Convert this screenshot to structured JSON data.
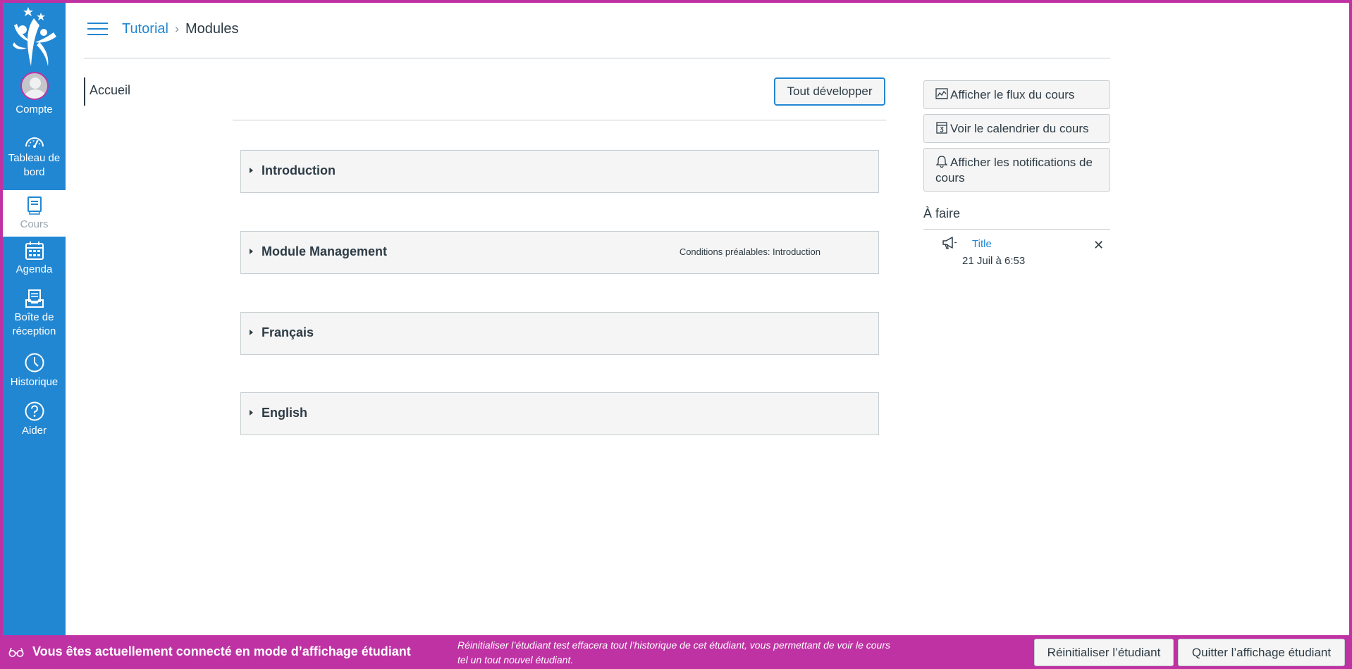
{
  "global_nav": {
    "items": [
      {
        "label": "Compte",
        "icon": "avatar"
      },
      {
        "label": "Tableau de bord",
        "icon": "dashboard-icon"
      },
      {
        "label": "Cours",
        "icon": "courses-icon",
        "active": true
      },
      {
        "label": "Agenda",
        "icon": "calendar-icon"
      },
      {
        "label": "Boîte de réception",
        "icon": "inbox-icon"
      },
      {
        "label": "Historique",
        "icon": "clock-icon"
      },
      {
        "label": "Aider",
        "icon": "help-icon"
      }
    ]
  },
  "breadcrumb": {
    "course": "Tutorial",
    "separator": "›",
    "current": "Modules"
  },
  "course_nav": {
    "items": [
      {
        "label": "Accueil"
      }
    ]
  },
  "toolbar": {
    "expand_all_label": "Tout développer"
  },
  "modules": [
    {
      "title": "Introduction",
      "prereq": ""
    },
    {
      "title": "Module Management",
      "prereq": "Conditions préalables: Introduction"
    },
    {
      "title": "Français",
      "prereq": ""
    },
    {
      "title": "English",
      "prereq": ""
    }
  ],
  "sidebar": {
    "buttons": [
      {
        "label": "Afficher le flux du cours",
        "icon": "stream-icon"
      },
      {
        "label": "Voir le calendrier du cours",
        "icon": "calendar-icon"
      },
      {
        "label": "Afficher les notifications de cours",
        "icon": "bell-icon"
      }
    ],
    "todo": {
      "title": "À faire",
      "items": [
        {
          "title": "Title",
          "date": "21 Juil à 6:53",
          "icon": "announcement-icon",
          "dismiss": "✕"
        }
      ]
    }
  },
  "student_view": {
    "title": "Vous êtes actuellement connecté en mode d’affichage étudiant",
    "description": "Réinitialiser l’étudiant test effacera tout l’historique de cet étudiant, vous permettant de voir le cours tel un tout nouvel étudiant.",
    "reset_label": "Réinitialiser l’étudiant",
    "leave_label": "Quitter l’affichage étudiant"
  },
  "colors": {
    "brand_blue": "#2187d3",
    "student_view_magenta": "#bf32a4",
    "text": "#2d3b45"
  }
}
